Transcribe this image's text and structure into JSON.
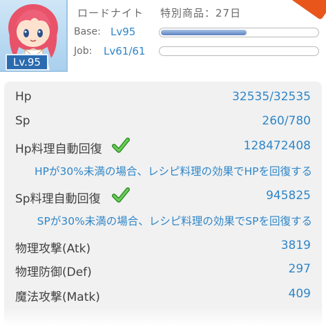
{
  "header": {
    "job_name": "ロードナイト",
    "special": "特別商品：27日",
    "avatar_level": "Lv.95",
    "base_label": "Base:",
    "base_value": "Lv95",
    "base_progress": 0.55,
    "job_label": "Job:",
    "job_value": "Lv61/61",
    "job_progress": 0.0
  },
  "stats": {
    "hp": {
      "label": "Hp",
      "value": "32535/32535"
    },
    "sp": {
      "label": "Sp",
      "value": "260/780"
    },
    "hp_auto": {
      "label": "Hp料理自動回復",
      "value": "128472408",
      "checked": true
    },
    "hp_note": "HPが30%未満の場合、レシピ料理の効果でHPを回復する",
    "sp_auto": {
      "label": "Sp料理自動回復",
      "value": "945825",
      "checked": true
    },
    "sp_note": "SPが30%未満の場合、レシピ料理の効果でSPを回復する",
    "atk": {
      "label": "物理攻撃(Atk)",
      "value": "3819"
    },
    "def": {
      "label": "物理防御(Def)",
      "value": "297"
    },
    "matk": {
      "label": "魔法攻撃(Matk)",
      "value": "409"
    }
  },
  "colors": {
    "accent_blue": "#2f86c8",
    "check_green": "#4caf3a",
    "badge_blue": "#2b6bb0"
  },
  "icons": {
    "check": "checkmark-icon",
    "avatar": "character-avatar"
  }
}
